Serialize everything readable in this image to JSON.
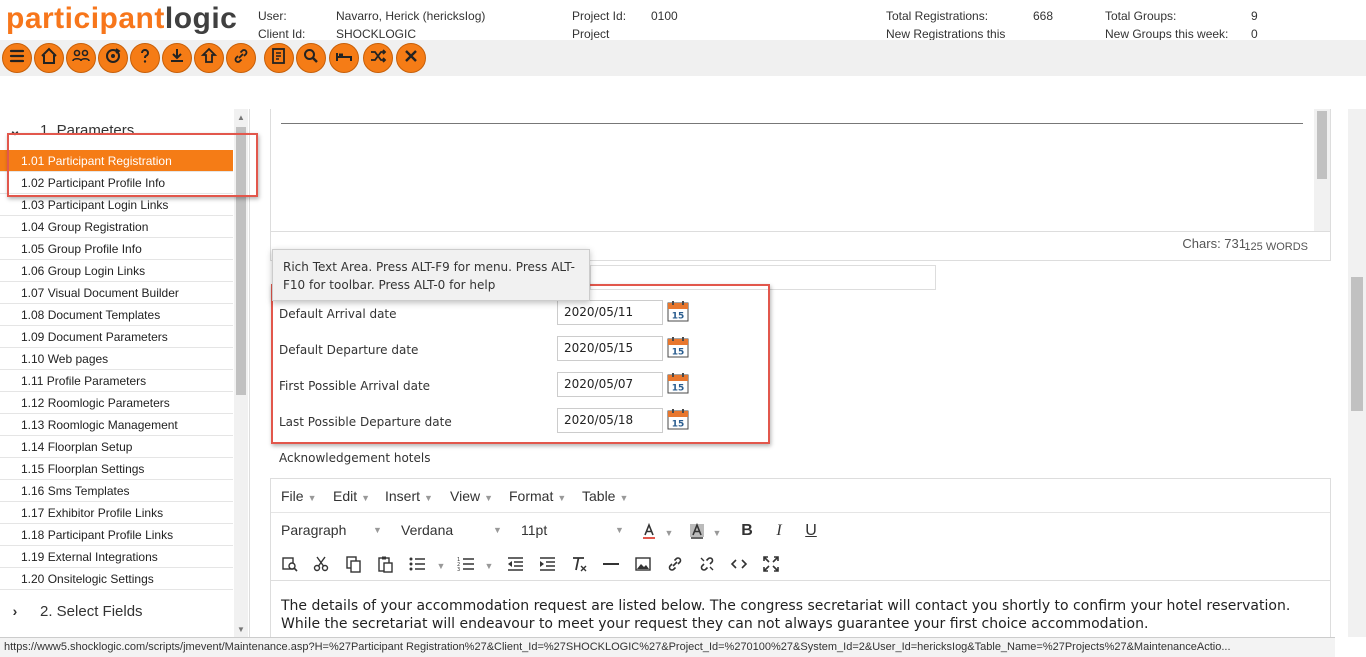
{
  "brand": {
    "part1": "participant",
    "part2": "logic",
    "accent": "#f57c16"
  },
  "header": {
    "user_label": "User:",
    "user_value": "Navarro, Herick (hericksIog)",
    "client_label": "Client Id:",
    "client_value": "SHOCKLOGIC",
    "project_label": "Project Id:",
    "project_value": "0100",
    "project2_label": "Project",
    "total_reg_label": "Total Registrations:",
    "total_reg_value": "668",
    "new_reg_label": "New Registrations this",
    "total_groups_label": "Total Groups:",
    "total_groups_value": "9",
    "new_groups_label": "New Groups this week:",
    "new_groups_value": "0"
  },
  "toolbar": {
    "icons": [
      "menu-icon",
      "home-icon",
      "groups-icon",
      "sync-icon",
      "help-icon",
      "download-icon",
      "upload-icon",
      "link-icon",
      "notes-icon",
      "search-icon",
      "bed-icon",
      "shuffle-icon",
      "close-icon"
    ]
  },
  "sidebar": {
    "section1": "1. Parameters",
    "section2": "2. Select Fields",
    "items": [
      "1.01 Participant Registration",
      "1.02 Participant Profile Info",
      "1.03 Participant Login Links",
      "1.04 Group Registration",
      "1.05 Group Profile Info",
      "1.06 Group Login Links",
      "1.07 Visual Document Builder",
      "1.08 Document Templates",
      "1.09 Document Parameters",
      "1.10 Web pages",
      "1.11 Profile Parameters",
      "1.12 Roomlogic Parameters",
      "1.13 Roomlogic Management",
      "1.14 Floorplan Setup",
      "1.15 Floorplan Settings",
      "1.16 Sms Templates",
      "1.17 Exhibitor Profile Links",
      "1.18 Participant Profile Links",
      "1.19 External Integrations",
      "1.20 Onsitelogic Settings"
    ]
  },
  "rta": {
    "chars": "Chars: 731",
    "words": "125 WORDS"
  },
  "tooltip": "Rich Text Area. Press ALT-F9 for menu. Press ALT-F10 for toolbar. Press ALT-0 for help",
  "dates": [
    {
      "label": "Default Arrival date",
      "value": "2020/05/11"
    },
    {
      "label": "Default Departure date",
      "value": "2020/05/15"
    },
    {
      "label": "First Possible Arrival date",
      "value": "2020/05/07"
    },
    {
      "label": "Last Possible Departure date",
      "value": "2020/05/18"
    }
  ],
  "calendar_day": "15",
  "ack_label": "Acknowledgement hotels",
  "editor": {
    "menus": [
      "File",
      "Edit",
      "Insert",
      "View",
      "Format",
      "Table"
    ],
    "block_format": "Paragraph",
    "font_family": "Verdana",
    "font_size": "11pt",
    "bold": "B",
    "italic": "I",
    "underline": "U",
    "content_line1": "The details of your accommodation request are listed below. The congress secretariat will contact you shortly to confirm your hotel reservation.",
    "content_line2": "While the secretariat will endeavour to meet your request they can not always guarantee your first choice accommodation."
  },
  "statusbar": "https://www5.shocklogic.com/scripts/jmevent/Maintenance.asp?H=%27Participant Registration%27&Client_Id=%27SHOCKLOGIC%27&Project_Id=%270100%27&System_Id=2&User_Id=hericksIog&Table_Name=%27Projects%27&MaintenanceActio..."
}
